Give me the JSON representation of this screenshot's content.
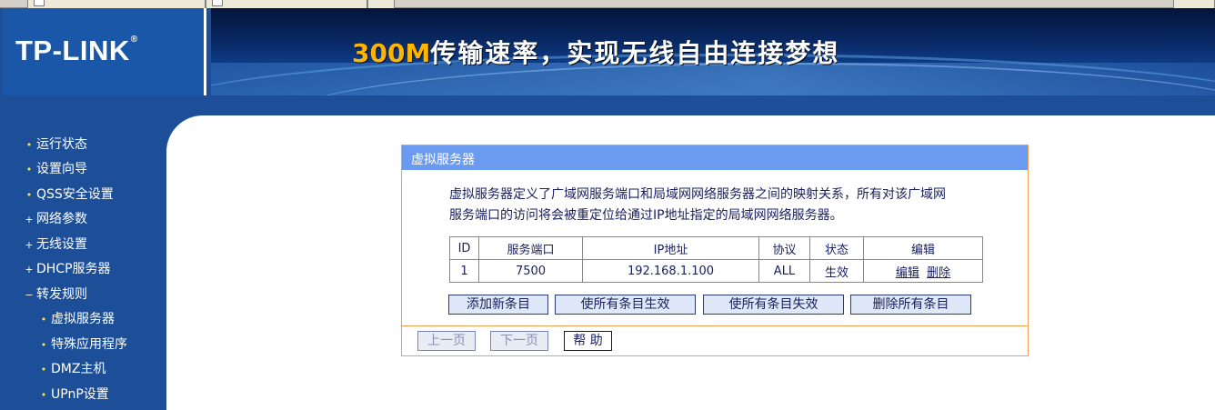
{
  "header": {
    "logo": "TP-LINK",
    "logo_mark": "®",
    "slogan_highlight": "300M",
    "slogan_rest": "传输速率，实现无线自由连接梦想"
  },
  "sidebar": {
    "items": [
      {
        "label": "运行状态",
        "marker": "•"
      },
      {
        "label": "设置向导",
        "marker": "•"
      },
      {
        "label": "QSS安全设置",
        "marker": "•"
      },
      {
        "label": "网络参数",
        "marker": "+"
      },
      {
        "label": "无线设置",
        "marker": "+"
      },
      {
        "label": "DHCP服务器",
        "marker": "+"
      },
      {
        "label": "转发规则",
        "marker": "−"
      },
      {
        "label": "虚拟服务器",
        "marker": "•"
      },
      {
        "label": "特殊应用程序",
        "marker": "•"
      },
      {
        "label": "DMZ主机",
        "marker": "•"
      },
      {
        "label": "UPnP设置",
        "marker": "•"
      }
    ]
  },
  "panel": {
    "title": "虚拟服务器",
    "description_line1": "虚拟服务器定义了广域网服务端口和局域网网络服务器之间的映射关系，所有对该广域网",
    "description_line2": "服务端口的访问将会被重定位给通过IP地址指定的局域网网络服务器。",
    "table": {
      "headers": [
        "ID",
        "服务端口",
        "IP地址",
        "协议",
        "状态",
        "编辑"
      ],
      "rows": [
        {
          "id": "1",
          "port": "7500",
          "ip": "192.168.1.100",
          "protocol": "ALL",
          "status": "生效",
          "edit": "编辑",
          "delete": "删除"
        }
      ]
    },
    "buttons": {
      "add": "添加新条目",
      "enable_all": "使所有条目生效",
      "disable_all": "使所有条目失效",
      "delete_all": "删除所有条目",
      "prev": "上一页",
      "next": "下一页",
      "help": "帮 助"
    }
  },
  "colors": {
    "nav_bg": "#1c4f98",
    "panel_title_bg": "#6b9bf0",
    "panel_border": "#f0a050",
    "slogan_highlight": "#ffb400"
  }
}
